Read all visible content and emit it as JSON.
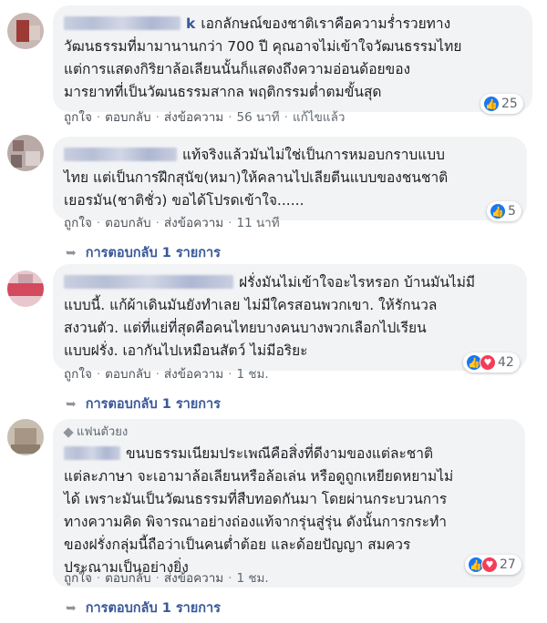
{
  "comments": [
    {
      "name_tail": "k",
      "text": "เอกลักษณ์ของชาติเราคือความร่ำรวยทางวัฒนธรรมที่มามานานกว่า 700 ปี คุณอาจไม่เข้าใจวัฒนธรรมไทยแต่การแสดงกิริยาล้อเลียนนั้นก็แสดงถึงความอ่อนด้อยของมารยาทที่เป็นวัฒนธรรมสากล พฤติกรรมต่ำตมขั้นสุด",
      "lines": [
        "เอกลักษณ์ของชาติเราคือความร่ำรวยทาง",
        "วัฒนธรรมที่มามานานกว่า 700 ปี คุณอาจไม่เข้าใจวัฒนธรรมไทย",
        "แต่การแสดงกิริยาล้อเลียนนั้นก็แสดงถึงความอ่อนด้อยของ",
        "มารยาทที่เป็นวัฒนธรรมสากล พฤติกรรมต่ำตมขั้นสุด"
      ],
      "like": "ถูกใจ",
      "reply": "ตอบกลับ",
      "message": "ส่งข้อความ",
      "time": "56 นาที",
      "edited": "แก้ไขแล้ว",
      "reaction_count": "25"
    },
    {
      "lines": [
        "แท้จริงแล้วมันไม่ใช่เป็นการหมอบกราบแบบ",
        "ไทย แต่เป็นการฝึกสุนัข(หมา)ให้คลานไปเลียตีนแบบของชนชาติ",
        "เยอรมัน(ชาติชั่ว) ขอได้โปรดเข้าใจ......"
      ],
      "like": "ถูกใจ",
      "reply": "ตอบกลับ",
      "message": "ส่งข้อความ",
      "time": "11 นาที",
      "reaction_count": "5",
      "replies_label": "การตอบกลับ 1 รายการ"
    },
    {
      "lines": [
        "ฝรั่งมันไม่เข้าใจอะไรหรอก บ้านมันไม่มี",
        "แบบนี้. แก้ผ้าเดินมันยังทำเลย ไม่มีใครสอนพวกเขา. ให้รักนวล",
        "สงวนตัว. แต่ที่แย่ที่สุดคือคนไทยบางคนบางพวกเลือกไปเรียน",
        "แบบฝรั่ง. เอากันไปเหมือนสัตว์ ไม่มีอริยะ"
      ],
      "like": "ถูกใจ",
      "reply": "ตอบกลับ",
      "message": "ส่งข้อความ",
      "time": "1 ชม.",
      "reaction_count": "42",
      "replies_label": "การตอบกลับ 1 รายการ"
    },
    {
      "badge": "แฟนตัวยง",
      "lines": [
        "ขนบธรรมเนียมประเพณีคือสิ่งที่ดีงามของแต่ละชาติ",
        "แต่ละภาษา จะเอามาล้อเลียนหรือล้อเล่น หรือดูถูกเหยียดหยามไม่",
        "ได้ เพราะมันเป็นวัฒนธรรมที่สืบทอดกันมา โดยผ่านกระบวนการ",
        "ทางความคิด พิจารณาอย่างถ่องแท้จากรุ่นสู่รุ่น ดังนั้นการกระทำ",
        "ของฝรั่งกลุ่มนี้ถือว่าเป็นคนต่ำต้อย และด้อยปัญญา สมควร",
        "ประณามเป็นอย่างยิ่ง"
      ],
      "like": "ถูกใจ",
      "reply": "ตอบกลับ",
      "message": "ส่งข้อความ",
      "time": "1 ชม.",
      "reaction_count": "27",
      "replies_label": "การตอบกลับ 1 รายการ"
    }
  ],
  "colors": {
    "bubble": "#f2f3f5",
    "link": "#385898",
    "like_blue": "#1877f2",
    "love_red": "#f33e58",
    "meta": "#606770"
  },
  "icons": [
    "like-icon",
    "love-icon",
    "reply-arrow-icon",
    "diamond-icon"
  ]
}
